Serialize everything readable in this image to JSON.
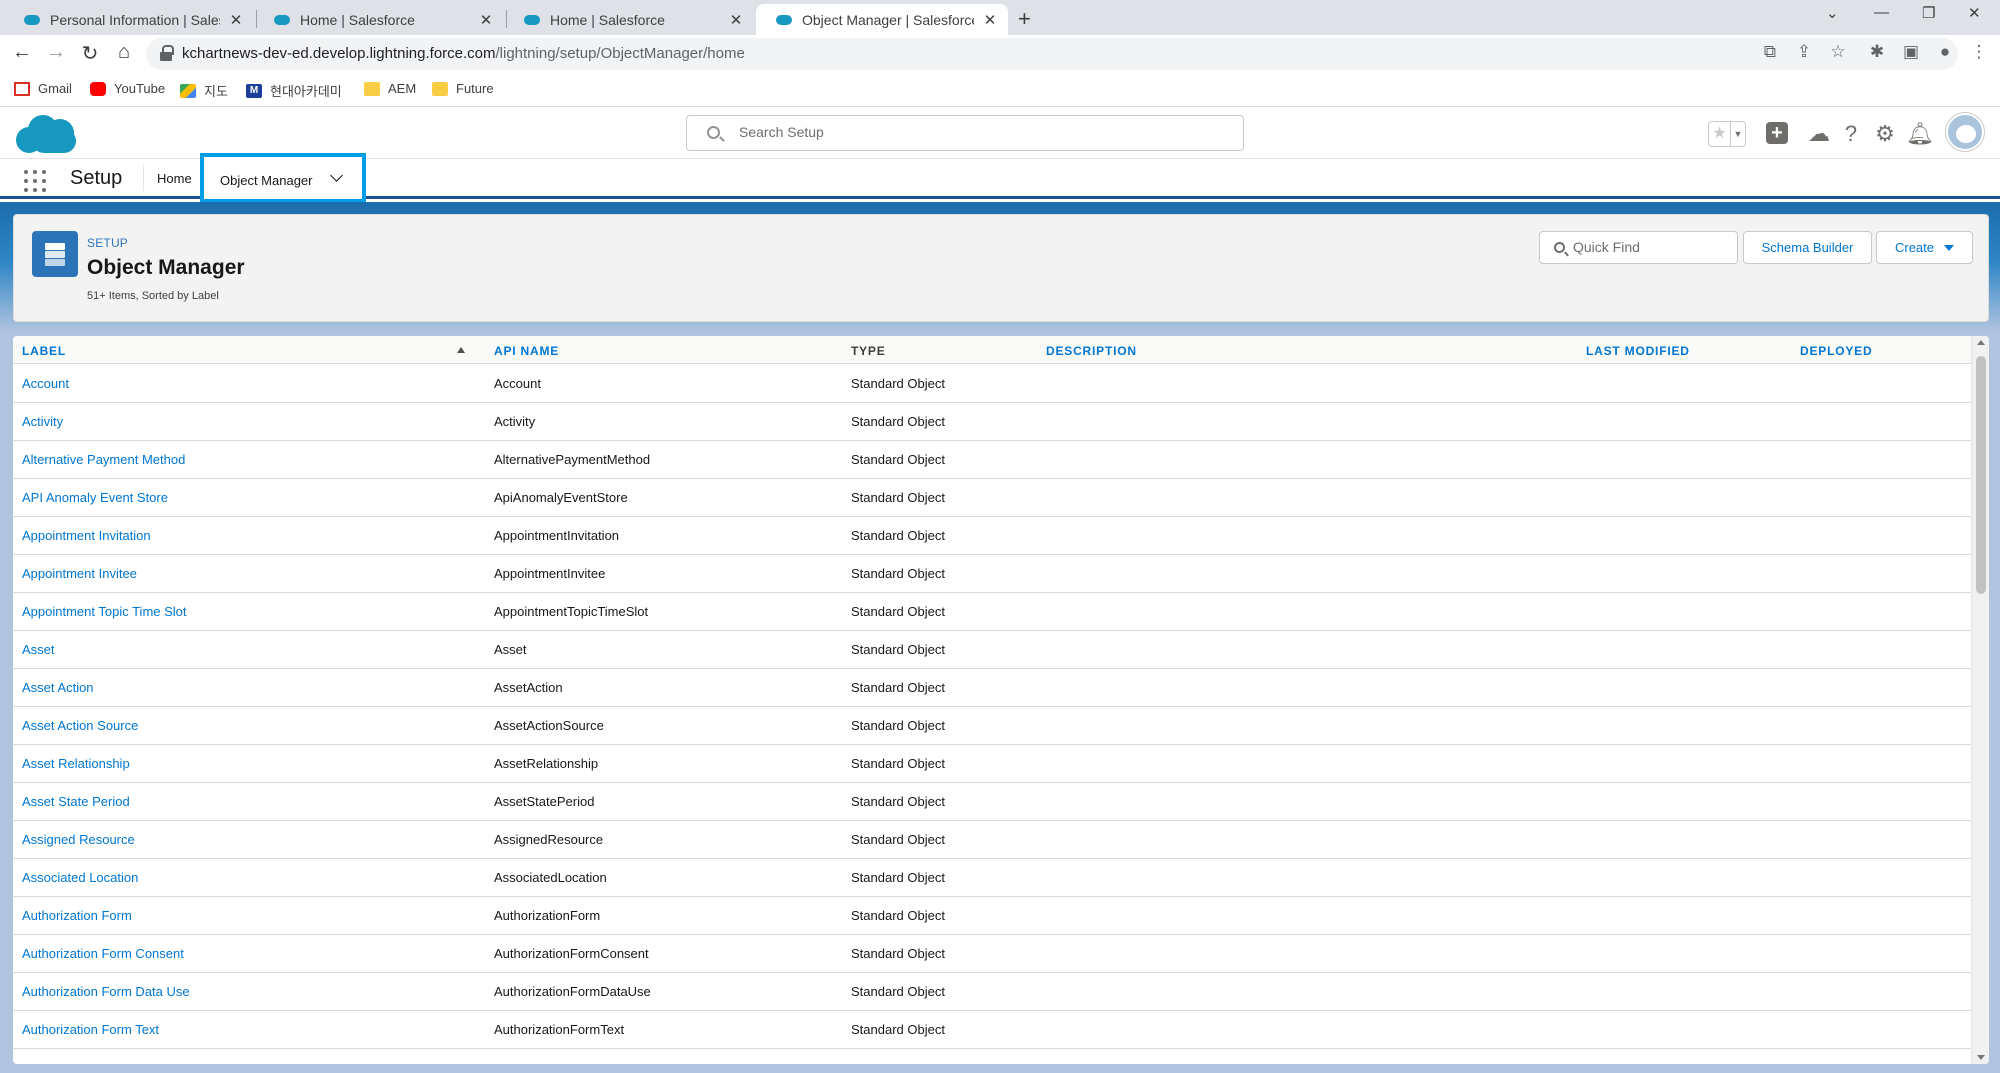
{
  "browser": {
    "tabs": [
      {
        "label": "Personal Information | Salesforce",
        "active": false
      },
      {
        "label": "Home | Salesforce",
        "active": false
      },
      {
        "label": "Home | Salesforce",
        "active": false
      },
      {
        "label": "Object Manager | Salesforce",
        "active": true
      }
    ],
    "new_tab": "+",
    "url_host": "kchartnews-dev-ed.develop.lightning.force.com",
    "url_path": "/lightning/setup/ObjectManager/home",
    "bookmarks": [
      "Gmail",
      "YouTube",
      "지도",
      "현대아카데미",
      "AEM",
      "Future"
    ]
  },
  "sf_header": {
    "search_placeholder": "Search Setup"
  },
  "context_nav": {
    "app_name": "Setup",
    "home_label": "Home",
    "object_manager_label": "Object Manager"
  },
  "page_header": {
    "eyebrow": "SETUP",
    "title": "Object Manager",
    "meta": "51+ Items, Sorted by Label",
    "quick_find_placeholder": "Quick Find",
    "schema_builder_label": "Schema Builder",
    "create_label": "Create"
  },
  "table": {
    "columns": {
      "label": "LABEL",
      "api_name": "API NAME",
      "type": "TYPE",
      "description": "DESCRIPTION",
      "last_modified": "LAST MODIFIED",
      "deployed": "DEPLOYED"
    },
    "rows": [
      {
        "label": "Account",
        "api": "Account",
        "type": "Standard Object"
      },
      {
        "label": "Activity",
        "api": "Activity",
        "type": "Standard Object"
      },
      {
        "label": "Alternative Payment Method",
        "api": "AlternativePaymentMethod",
        "type": "Standard Object"
      },
      {
        "label": "API Anomaly Event Store",
        "api": "ApiAnomalyEventStore",
        "type": "Standard Object"
      },
      {
        "label": "Appointment Invitation",
        "api": "AppointmentInvitation",
        "type": "Standard Object"
      },
      {
        "label": "Appointment Invitee",
        "api": "AppointmentInvitee",
        "type": "Standard Object"
      },
      {
        "label": "Appointment Topic Time Slot",
        "api": "AppointmentTopicTimeSlot",
        "type": "Standard Object"
      },
      {
        "label": "Asset",
        "api": "Asset",
        "type": "Standard Object"
      },
      {
        "label": "Asset Action",
        "api": "AssetAction",
        "type": "Standard Object"
      },
      {
        "label": "Asset Action Source",
        "api": "AssetActionSource",
        "type": "Standard Object"
      },
      {
        "label": "Asset Relationship",
        "api": "AssetRelationship",
        "type": "Standard Object"
      },
      {
        "label": "Asset State Period",
        "api": "AssetStatePeriod",
        "type": "Standard Object"
      },
      {
        "label": "Assigned Resource",
        "api": "AssignedResource",
        "type": "Standard Object"
      },
      {
        "label": "Associated Location",
        "api": "AssociatedLocation",
        "type": "Standard Object"
      },
      {
        "label": "Authorization Form",
        "api": "AuthorizationForm",
        "type": "Standard Object"
      },
      {
        "label": "Authorization Form Consent",
        "api": "AuthorizationFormConsent",
        "type": "Standard Object"
      },
      {
        "label": "Authorization Form Data Use",
        "api": "AuthorizationFormDataUse",
        "type": "Standard Object"
      },
      {
        "label": "Authorization Form Text",
        "api": "AuthorizationFormText",
        "type": "Standard Object"
      }
    ]
  },
  "colors": {
    "brand_blue": "#1798c1",
    "link_blue": "#0176d3",
    "highlight_border": "#009fe5"
  }
}
